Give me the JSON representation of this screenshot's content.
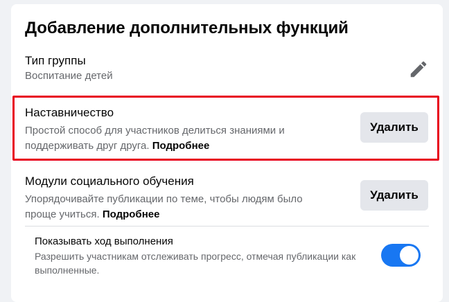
{
  "page": {
    "title": "Добавление дополнительных функций"
  },
  "group_type": {
    "label": "Тип группы",
    "value": "Воспитание детей",
    "edit_icon": "pencil-icon"
  },
  "features": [
    {
      "title": "Наставничество",
      "description": "Простой способ для участников делиться знаниями и поддерживать друг друга.",
      "more_link": "Подробнее",
      "action_label": "Удалить",
      "highlighted": true
    },
    {
      "title": "Модули социального обучения",
      "description": "Упорядочивайте публикации по теме, чтобы людям было проще учиться.",
      "more_link": "Подробнее",
      "action_label": "Удалить",
      "highlighted": false
    }
  ],
  "progress_setting": {
    "title": "Показывать ход выполнения",
    "description": "Разрешить участникам отслеживать прогресс, отмечая публикации как выполненные.",
    "enabled": true
  },
  "colors": {
    "accent": "#1877f2",
    "highlight_border": "#e8001c",
    "button_bg": "#e4e6eb",
    "secondary_text": "#65676b"
  }
}
